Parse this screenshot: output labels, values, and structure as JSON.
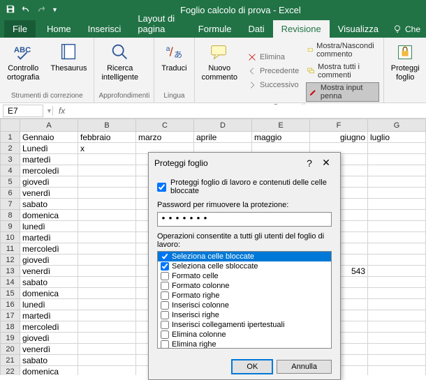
{
  "titlebar": {
    "document": "Foglio calcolo di prova - Excel"
  },
  "tabs": {
    "file": "File",
    "home": "Home",
    "inserisci": "Inserisci",
    "layout": "Layout di pagina",
    "formule": "Formule",
    "dati": "Dati",
    "revisione": "Revisione",
    "visualizza": "Visualizza",
    "tell": "Che"
  },
  "ribbon": {
    "controllo": "Controllo\nortografia",
    "thesaurus": "Thesaurus",
    "group1": "Strumenti di correzione",
    "ricerca": "Ricerca\nintelligente",
    "group2": "Approfondimenti",
    "traduci": "Traduci",
    "group3": "Lingua",
    "nuovo": "Nuovo\ncommento",
    "elimina": "Elimina",
    "precedente": "Precedente",
    "successivo": "Successivo",
    "mostraNascondi": "Mostra/Nascondi commento",
    "mostraTutti": "Mostra tutti i commenti",
    "mostraInput": "Mostra input penna",
    "group4": "Commenti",
    "proteggi": "Proteggi\nfoglio"
  },
  "namebox": "E7",
  "columns": [
    "A",
    "B",
    "C",
    "D",
    "E",
    "F",
    "G"
  ],
  "rows": [
    {
      "n": 1,
      "A": "Gennaio",
      "B": "febbraio",
      "C": "marzo",
      "D": "aprile",
      "E": "maggio",
      "F": "giugno",
      "G": "luglio"
    },
    {
      "n": 2,
      "A": "Lunedì",
      "B": "x"
    },
    {
      "n": 3,
      "A": "martedì"
    },
    {
      "n": 4,
      "A": "mercoledì"
    },
    {
      "n": 5,
      "A": "giovedì"
    },
    {
      "n": 6,
      "A": "venerdì"
    },
    {
      "n": 7,
      "A": "sabato"
    },
    {
      "n": 8,
      "A": "domenica"
    },
    {
      "n": 9,
      "A": "lunedì"
    },
    {
      "n": 10,
      "A": "martedì"
    },
    {
      "n": 11,
      "A": "mercoledì"
    },
    {
      "n": 12,
      "A": "giovedì"
    },
    {
      "n": 13,
      "A": "venerdì",
      "F": "543"
    },
    {
      "n": 14,
      "A": "sabato"
    },
    {
      "n": 15,
      "A": "domenica"
    },
    {
      "n": 16,
      "A": "lunedì"
    },
    {
      "n": 17,
      "A": "martedì"
    },
    {
      "n": 18,
      "A": "mercoledì"
    },
    {
      "n": 19,
      "A": "giovedì"
    },
    {
      "n": 20,
      "A": "venerdì"
    },
    {
      "n": 21,
      "A": "sabato"
    },
    {
      "n": 22,
      "A": "domenica"
    }
  ],
  "dialog": {
    "title": "Proteggi foglio",
    "protectLabel": "Proteggi foglio di lavoro e contenuti delle celle bloccate",
    "passwordLabel": "Password per rimuovere la protezione:",
    "passwordValue": "•••••••",
    "permLabel": "Operazioni consentite a tutti gli utenti del foglio di lavoro:",
    "perms": [
      {
        "label": "Seleziona celle bloccate",
        "chk": true,
        "sel": true
      },
      {
        "label": "Seleziona celle sbloccate",
        "chk": true
      },
      {
        "label": "Formato celle",
        "chk": false
      },
      {
        "label": "Formato colonne",
        "chk": false
      },
      {
        "label": "Formato righe",
        "chk": false
      },
      {
        "label": "Inserisci colonne",
        "chk": false
      },
      {
        "label": "Inserisci righe",
        "chk": false
      },
      {
        "label": "Inserisci collegamenti ipertestuali",
        "chk": false
      },
      {
        "label": "Elimina colonne",
        "chk": false
      },
      {
        "label": "Elimina righe",
        "chk": false
      }
    ],
    "ok": "OK",
    "cancel": "Annulla"
  }
}
